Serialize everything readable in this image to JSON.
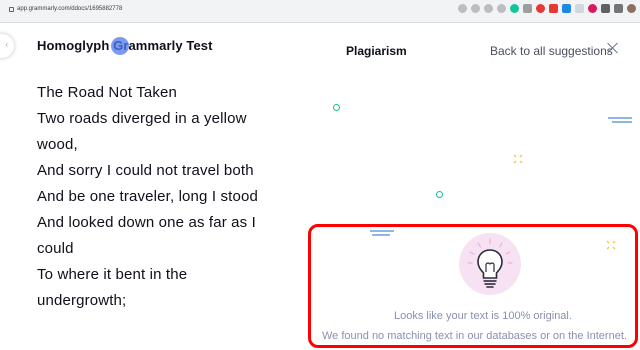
{
  "browser": {
    "url": "app.grammarly.com/ddocs/1695882778"
  },
  "document": {
    "title": "Homoglyph Grammarly Test",
    "lines": [
      "The Road Not Taken",
      "Two roads diverged in a yellow",
      "wood,",
      "And sorry I could not travel both",
      "And be one traveler, long I stood",
      "And looked down one as far as I",
      "could",
      "To where it bent in the",
      "undergrowth;"
    ]
  },
  "panel": {
    "title": "Plagiarism",
    "back_label": "Back to all suggestions",
    "result_title": "Looks like your text is 100% original.",
    "result_detail": "We found no matching text in our databases or on the Internet."
  },
  "colors": {
    "highlight": "#ff0000",
    "accent_green": "#15c39a",
    "grammarly_blue": "#4f78f0",
    "bulb_bg": "#f6e2f2"
  }
}
